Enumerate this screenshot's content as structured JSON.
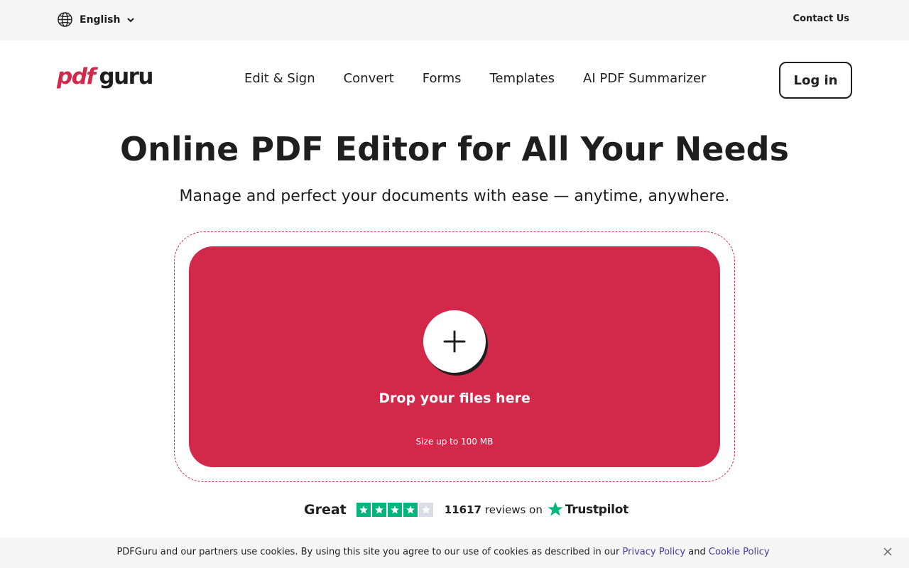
{
  "topbar": {
    "language": "English",
    "contact_label": "Contact Us"
  },
  "header": {
    "logo_pdf": "pdf",
    "logo_guru": "guru",
    "nav": [
      {
        "label": "Edit & Sign"
      },
      {
        "label": "Convert"
      },
      {
        "label": "Forms"
      },
      {
        "label": "Templates"
      },
      {
        "label": "AI PDF Summarizer"
      }
    ],
    "login_label": "Log in"
  },
  "hero": {
    "title": "Online PDF Editor for All Your Needs",
    "subtitle": "Manage and perfect your documents with ease — anytime, anywhere."
  },
  "upload": {
    "drop_label": "Drop your files here",
    "size_label": "Size up to 100 MB",
    "icon": "plus-icon"
  },
  "rating": {
    "word": "Great",
    "stars_filled": 4,
    "stars_total": 5,
    "review_count": "11617",
    "reviews_on": "reviews on",
    "provider": "Trustpilot"
  },
  "cookie": {
    "text_before": "PDFGuru and our partners use cookies. By using this site you agree to our use of cookies as described in our",
    "privacy_link": "Privacy Policy",
    "and_text": "and",
    "cookie_link": "Cookie Policy"
  },
  "colors": {
    "brand": "#d2294b",
    "trustpilot_green": "#00b67a",
    "text": "#1e1e1e",
    "link": "#4a3aa0"
  }
}
